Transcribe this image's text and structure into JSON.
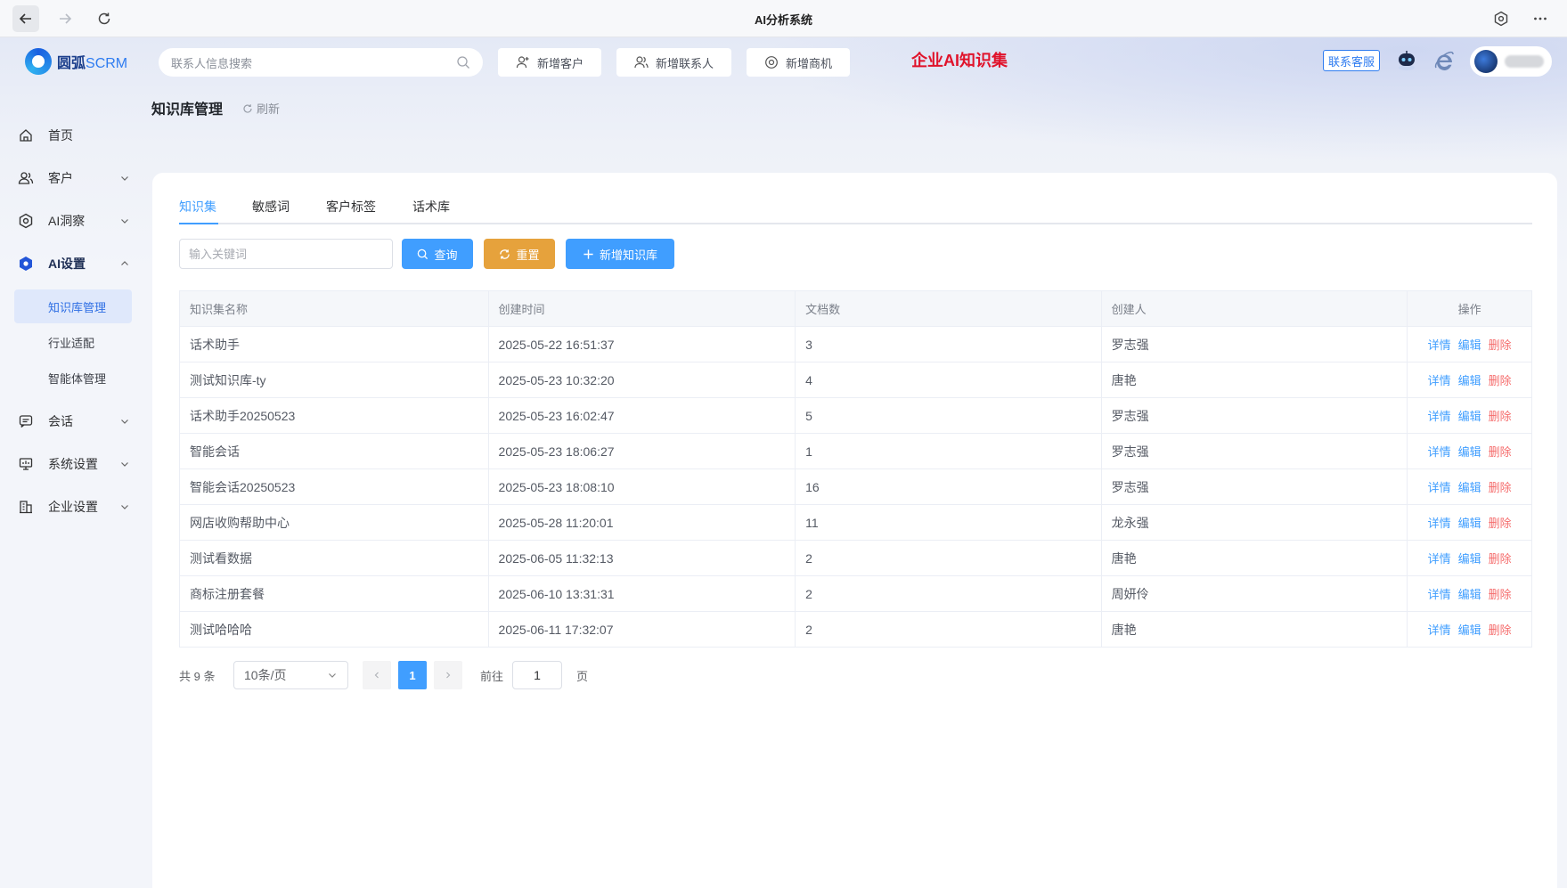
{
  "window": {
    "title": "AI分析系统"
  },
  "header": {
    "logo_cn": "圆弧",
    "logo_en": "SCRM",
    "search_placeholder": "联系人信息搜索",
    "btn_add_customer": "新增客户",
    "btn_add_contact": "新增联系人",
    "btn_add_opportunity": "新增商机",
    "banner": "企业AI知识集",
    "service": "联系客服"
  },
  "sidebar": {
    "home": "首页",
    "customer": "客户",
    "ai_insight": "AI洞察",
    "ai_settings": "AI设置",
    "sub_kb": "知识库管理",
    "sub_industry": "行业适配",
    "sub_agent": "智能体管理",
    "session": "会话",
    "system": "系统设置",
    "enterprise": "企业设置"
  },
  "page": {
    "title": "知识库管理",
    "refresh": "刷新"
  },
  "tabs": [
    "知识集",
    "敏感词",
    "客户标签",
    "话术库"
  ],
  "toolbar": {
    "keyword_placeholder": "输入关键词",
    "query": "查询",
    "reset": "重置",
    "add": "新增知识库"
  },
  "table": {
    "headers": [
      "知识集名称",
      "创建时间",
      "文档数",
      "创建人",
      "操作"
    ],
    "actions": {
      "detail": "详情",
      "edit": "编辑",
      "delete": "删除"
    },
    "rows": [
      [
        "话术助手",
        "2025-05-22 16:51:37",
        "3",
        "罗志强"
      ],
      [
        "测试知识库-ty",
        "2025-05-23 10:32:20",
        "4",
        "唐艳"
      ],
      [
        "话术助手20250523",
        "2025-05-23 16:02:47",
        "5",
        "罗志强"
      ],
      [
        "智能会话",
        "2025-05-23 18:06:27",
        "1",
        "罗志强"
      ],
      [
        "智能会话20250523",
        "2025-05-23 18:08:10",
        "16",
        "罗志强"
      ],
      [
        "网店收购帮助中心",
        "2025-05-28 11:20:01",
        "11",
        "龙永强"
      ],
      [
        "测试看数据",
        "2025-06-05 11:32:13",
        "2",
        "唐艳"
      ],
      [
        "商标注册套餐",
        "2025-06-10 13:31:31",
        "2",
        "周妍伶"
      ],
      [
        "测试哈哈哈",
        "2025-06-11 17:32:07",
        "2",
        "唐艳"
      ]
    ]
  },
  "pagination": {
    "total": "共 9 条",
    "page_size": "10条/页",
    "current": "1",
    "goto_label": "前往",
    "goto_value": "1",
    "goto_suffix": "页"
  },
  "colors": {
    "primary": "#409eff",
    "warning": "#e6a23c",
    "danger": "#f56c6c",
    "banner": "#e0132b"
  },
  "icons": [
    "back-arrow-icon",
    "forward-arrow-icon",
    "reload-icon",
    "settings-icon",
    "more-icon",
    "search-icon",
    "robot-icon",
    "browser-icon"
  ]
}
